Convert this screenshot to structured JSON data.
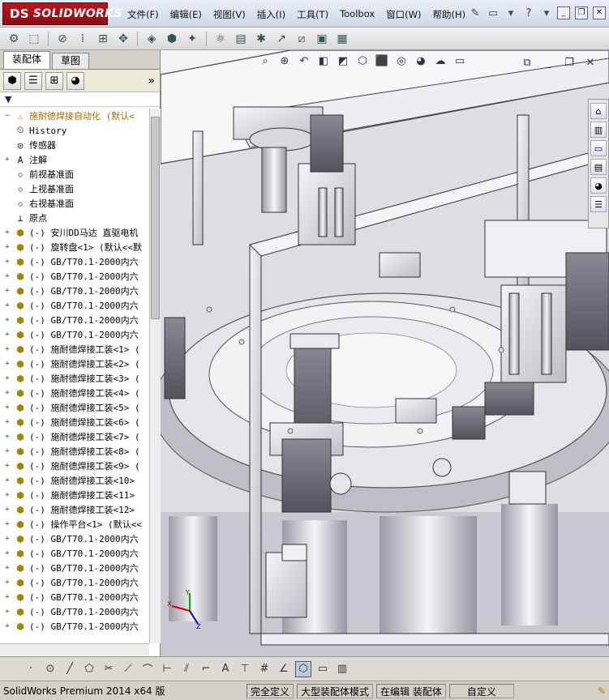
{
  "app": {
    "logo": "SOLIDWORKS",
    "logo_prefix": "DS"
  },
  "menu": [
    "文件(F)",
    "编辑(E)",
    "视图(V)",
    "插入(I)",
    "工具(T)",
    "Toolbox",
    "窗口(W)",
    "帮助(H)"
  ],
  "panel_tabs": [
    "装配体",
    "草图"
  ],
  "tree": [
    {
      "label": "施耐德焊接自动化 (默认<",
      "icon": "assembly-warning-icon",
      "expander": "−"
    },
    {
      "label": "History",
      "icon": "history-icon",
      "expander": ""
    },
    {
      "label": "传感器",
      "icon": "sensor-icon",
      "expander": ""
    },
    {
      "label": "注解",
      "icon": "annotation-icon",
      "expander": "+"
    },
    {
      "label": "前视基准面",
      "icon": "plane-icon",
      "expander": ""
    },
    {
      "label": "上视基准面",
      "icon": "plane-icon",
      "expander": ""
    },
    {
      "label": "右视基准面",
      "icon": "plane-icon",
      "expander": ""
    },
    {
      "label": "原点",
      "icon": "origin-icon",
      "expander": ""
    },
    {
      "label": "(-) 安川DD马达 直驱电机",
      "icon": "component-icon",
      "expander": "+"
    },
    {
      "label": "(-) 旋转盘<1> (默认<<默",
      "icon": "component-icon",
      "expander": "+"
    },
    {
      "label": "(-) GB/T70.1-2000内六",
      "icon": "component-icon",
      "expander": "+"
    },
    {
      "label": "(-) GB/T70.1-2000内六",
      "icon": "component-icon",
      "expander": "+"
    },
    {
      "label": "(-) GB/T70.1-2000内六",
      "icon": "component-icon",
      "expander": "+"
    },
    {
      "label": "(-) GB/T70.1-2000内六",
      "icon": "component-icon",
      "expander": "+"
    },
    {
      "label": "(-) GB/T70.1-2000内六",
      "icon": "component-icon",
      "expander": "+"
    },
    {
      "label": "(-) GB/T70.1-2000内六",
      "icon": "component-icon",
      "expander": "+"
    },
    {
      "label": "(-) 施耐德焊接工装<1> (",
      "icon": "component-icon",
      "expander": "+"
    },
    {
      "label": "(-) 施耐德焊接工装<2> (",
      "icon": "component-icon",
      "expander": "+"
    },
    {
      "label": "(-) 施耐德焊接工装<3> (",
      "icon": "component-icon",
      "expander": "+"
    },
    {
      "label": "(-) 施耐德焊接工装<4> (",
      "icon": "component-icon",
      "expander": "+"
    },
    {
      "label": "(-) 施耐德焊接工装<5> (",
      "icon": "component-icon",
      "expander": "+"
    },
    {
      "label": "(-) 施耐德焊接工装<6> (",
      "icon": "component-icon",
      "expander": "+"
    },
    {
      "label": "(-) 施耐德焊接工装<7> (",
      "icon": "component-icon",
      "expander": "+"
    },
    {
      "label": "(-) 施耐德焊接工装<8> (",
      "icon": "component-icon",
      "expander": "+"
    },
    {
      "label": "(-) 施耐德焊接工装<9> (",
      "icon": "component-icon",
      "expander": "+"
    },
    {
      "label": "(-) 施耐德焊接工装<10>",
      "icon": "component-icon",
      "expander": "+"
    },
    {
      "label": "(-) 施耐德焊接工装<11>",
      "icon": "component-icon",
      "expander": "+"
    },
    {
      "label": "(-) 施耐德焊接工装<12>",
      "icon": "component-icon",
      "expander": "+"
    },
    {
      "label": "(-) 操作平台<1> (默认<<",
      "icon": "component-icon",
      "expander": "+"
    },
    {
      "label": "(-) GB/T70.1-2000内六",
      "icon": "component-icon",
      "expander": "+"
    },
    {
      "label": "(-) GB/T70.1-2000内六",
      "icon": "component-icon",
      "expander": "+"
    },
    {
      "label": "(-) GB/T70.1-2000内六",
      "icon": "component-icon",
      "expander": "+"
    },
    {
      "label": "(-) GB/T70.1-2000内六",
      "icon": "component-icon",
      "expander": "+"
    },
    {
      "label": "(-) GB/T70.1-2000内六",
      "icon": "component-icon",
      "expander": "+"
    },
    {
      "label": "(-) GB/T70.1-2000内六",
      "icon": "component-icon",
      "expander": "+"
    },
    {
      "label": "(-) GB/T70.1-2000内六",
      "icon": "component-icon",
      "expander": "+"
    }
  ],
  "status": {
    "product": "SolidWorks Premium 2014 x64 版",
    "fully_defined": "完全定义",
    "large_assembly": "大型装配体模式",
    "editing": "在编辑 装配体",
    "custom": "自定义"
  }
}
